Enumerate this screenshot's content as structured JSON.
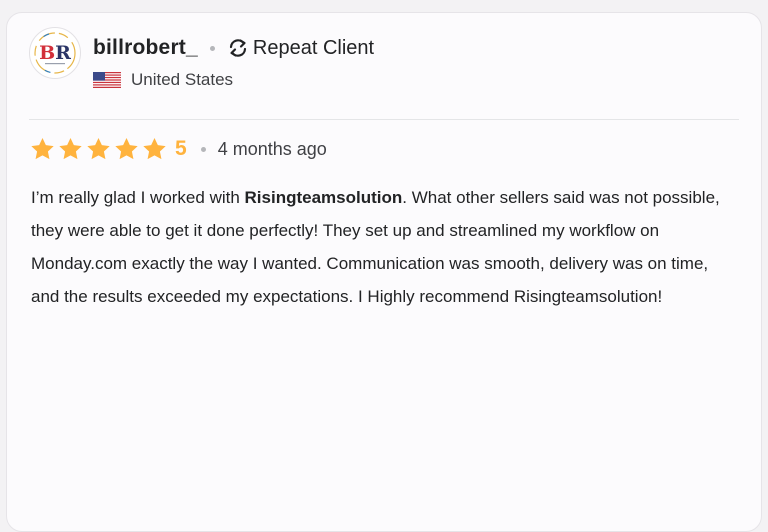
{
  "reviewer": {
    "avatar_initials": "BR",
    "username": "billrobert_",
    "repeat_label": "Repeat Client",
    "country": "United States"
  },
  "rating": {
    "stars": 5,
    "score_label": "5",
    "time_ago": "4 months ago"
  },
  "review": {
    "text_before": "I’m really glad I worked with ",
    "seller_name": "Risingteamsolution",
    "text_after": ". What other sellers said was not possible, they were able to get it done perfectly! They set up and streamlined my workflow on Monday.com exactly the way I wanted. Communication was smooth, delivery was on time, and the results exceeded my expectations. I Highly recommend Risingteamsolution!"
  },
  "colors": {
    "star": "#ffb33e",
    "text": "#222325",
    "muted": "#404145",
    "avatar_red": "#d2303a",
    "avatar_navy": "#2b3566"
  },
  "icons": {
    "repeat": "repeat-icon",
    "flag": "us-flag-icon",
    "star": "star-icon"
  }
}
